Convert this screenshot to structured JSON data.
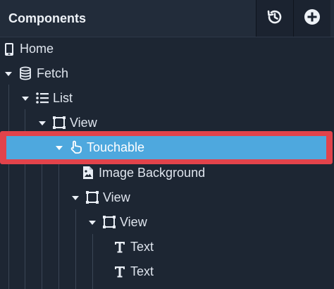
{
  "header": {
    "title": "Components",
    "history_icon": "history-icon",
    "add_icon": "add-circle-icon"
  },
  "tree": [
    {
      "label": "Home",
      "icon": "phone-icon",
      "expanded": null,
      "selected": false
    },
    {
      "label": "Fetch",
      "icon": "database-icon",
      "expanded": true,
      "selected": false
    },
    {
      "label": "List",
      "icon": "list-icon",
      "expanded": true,
      "selected": false
    },
    {
      "label": "View",
      "icon": "square-frame-icon",
      "expanded": true,
      "selected": false
    },
    {
      "label": "Touchable",
      "icon": "hand-pointer-icon",
      "expanded": true,
      "selected": true
    },
    {
      "label": "Image Background",
      "icon": "image-file-icon",
      "expanded": null,
      "selected": false
    },
    {
      "label": "View",
      "icon": "square-frame-icon",
      "expanded": true,
      "selected": false
    },
    {
      "label": "View",
      "icon": "square-frame-icon",
      "expanded": true,
      "selected": false
    },
    {
      "label": "Text",
      "icon": "text-icon",
      "expanded": null,
      "selected": false
    },
    {
      "label": "Text",
      "icon": "text-icon",
      "expanded": null,
      "selected": false
    }
  ],
  "colors": {
    "background": "#1d2633",
    "selected": "#4ea8de",
    "highlight_outline": "#e2434b"
  }
}
